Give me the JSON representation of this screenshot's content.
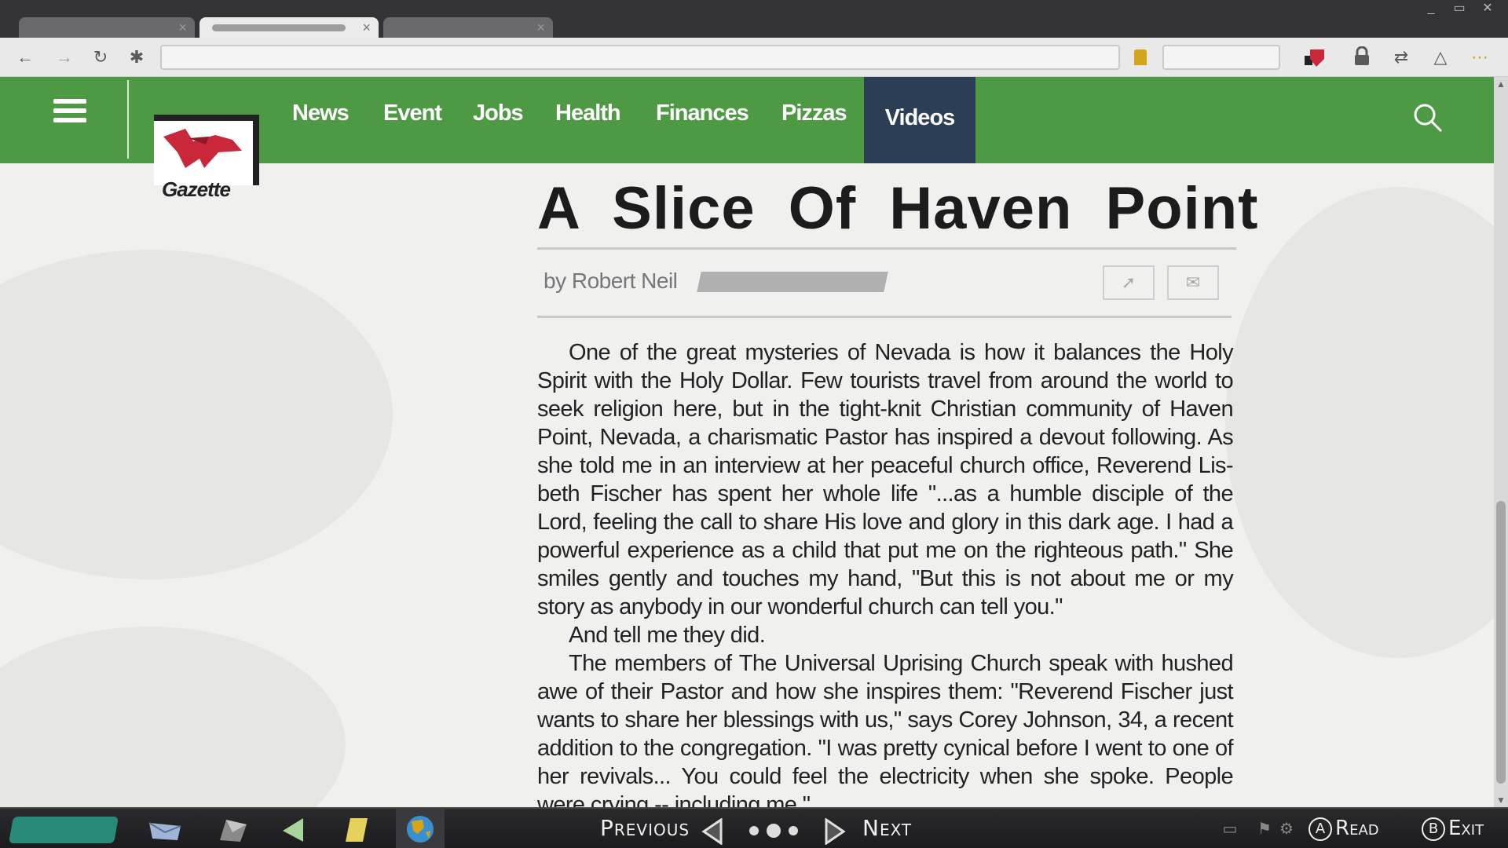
{
  "browser": {
    "tabs": [
      {
        "state": "inactive"
      },
      {
        "state": "active"
      },
      {
        "state": "inactive"
      }
    ],
    "window_controls": [
      "_",
      "▭",
      "✕"
    ]
  },
  "site": {
    "logo_text": "Gazette",
    "nav_items": [
      "News",
      "Event",
      "Jobs",
      "Health",
      "Finances",
      "Pizzas",
      "Videos"
    ],
    "active_nav": "Videos",
    "colors": {
      "nav_green": "#4e9a44",
      "active_tab": "#2c3e56",
      "logo_red": "#c8283a"
    }
  },
  "article": {
    "title": "A Slice Of Haven Point",
    "byline": "by Robert Neil",
    "paragraphs": [
      "One of the great mysteries of Nevada is how it balances the Holy Spirit with the Holy Dollar. Few tourists travel from around the world to seek religion here, but in the tight-knit Christian community of Haven Point, Nevada, a charismatic Pastor has inspired a devout following. As she told me in an interview at her peaceful church office, Reverend Lis-beth Fischer has spent her whole life \"...as a humble disciple of the Lord, feeling the call to share His love and glory in this dark age. I had a powerful experience as a child that put me on the righteous path.\" She smiles gently and touches my hand,  \"But this is not about me or my story as anybody in our wonderful church can tell you.\"",
      "And tell me they did.",
      "The members of The Universal Uprising Church speak with hushed awe of their Pastor and how she inspires them: \"Reverend Fischer just wants to share her blessings with us,\" says Corey Johnson, 34, a recent addition to the congregation. \"I was pretty cynical before I went to one of her revivals... You could feel the electricity when she spoke. People were crying -- including me.\""
    ]
  },
  "bottom_bar": {
    "previous_label": "Previous",
    "next_label": "Next",
    "read_button": "A",
    "read_label": "Read",
    "exit_button": "B",
    "exit_label": "Exit"
  }
}
